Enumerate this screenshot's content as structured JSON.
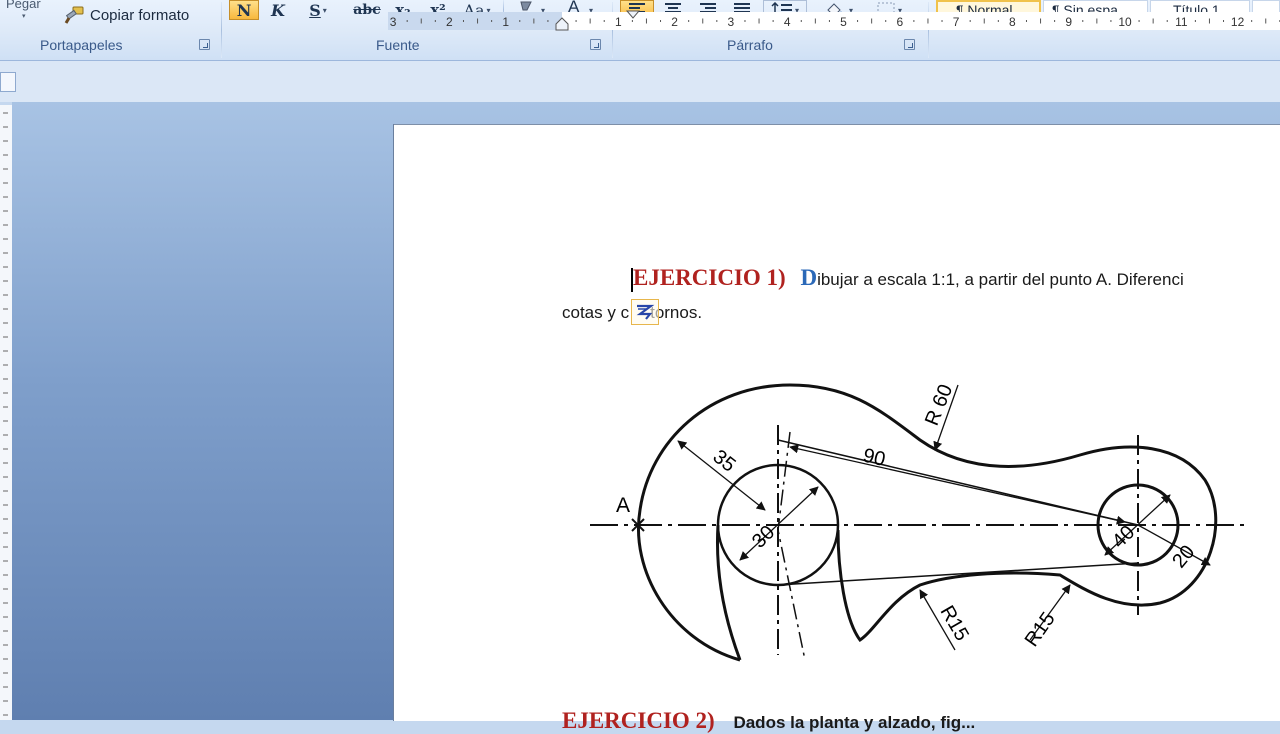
{
  "ribbon": {
    "clipboard": {
      "paste_label": "Pegar",
      "copy_format_label": "Copiar formato",
      "group_label": "Portapapeles"
    },
    "font": {
      "group_label": "Fuente",
      "bold": "N",
      "italic": "K",
      "underline": "S",
      "strike": "abc",
      "subscript": "x₂",
      "superscript": "x²",
      "change_case": "Aa",
      "font_color": "A"
    },
    "paragraph": {
      "group_label": "Párrafo"
    },
    "styles": {
      "items": [
        "¶ Normal",
        "¶ Sin espa...",
        "Título 1"
      ],
      "active": "¶ Normal"
    }
  },
  "ruler": {
    "marks": [
      "3",
      "2",
      "1",
      "1",
      "2",
      "3",
      "4",
      "5",
      "6",
      "7",
      "8",
      "9",
      "10",
      "11",
      "12"
    ]
  },
  "document": {
    "exercise1_title": "EJERCICIO 1)",
    "exercise1_dropcap": "D",
    "exercise1_line1_rest": "ibujar a escala 1:1, a partir del punto A. Diferenci",
    "exercise1_line2a": "cotas y c",
    "exercise1_line2b": "tornos.",
    "exercise2_title": "EJERCICIO 2)",
    "exercise2_rest": "Dados la planta y alzado, fig..."
  },
  "drawing": {
    "point_label": "A",
    "dimensions": [
      "35",
      "30",
      "90",
      "R 60",
      "40",
      "20",
      "R15",
      "R15"
    ]
  },
  "colors": {
    "title_red": "#b0221f",
    "dropcap_blue": "#2b69b8",
    "ribbon_blue": "#dde9f8"
  }
}
